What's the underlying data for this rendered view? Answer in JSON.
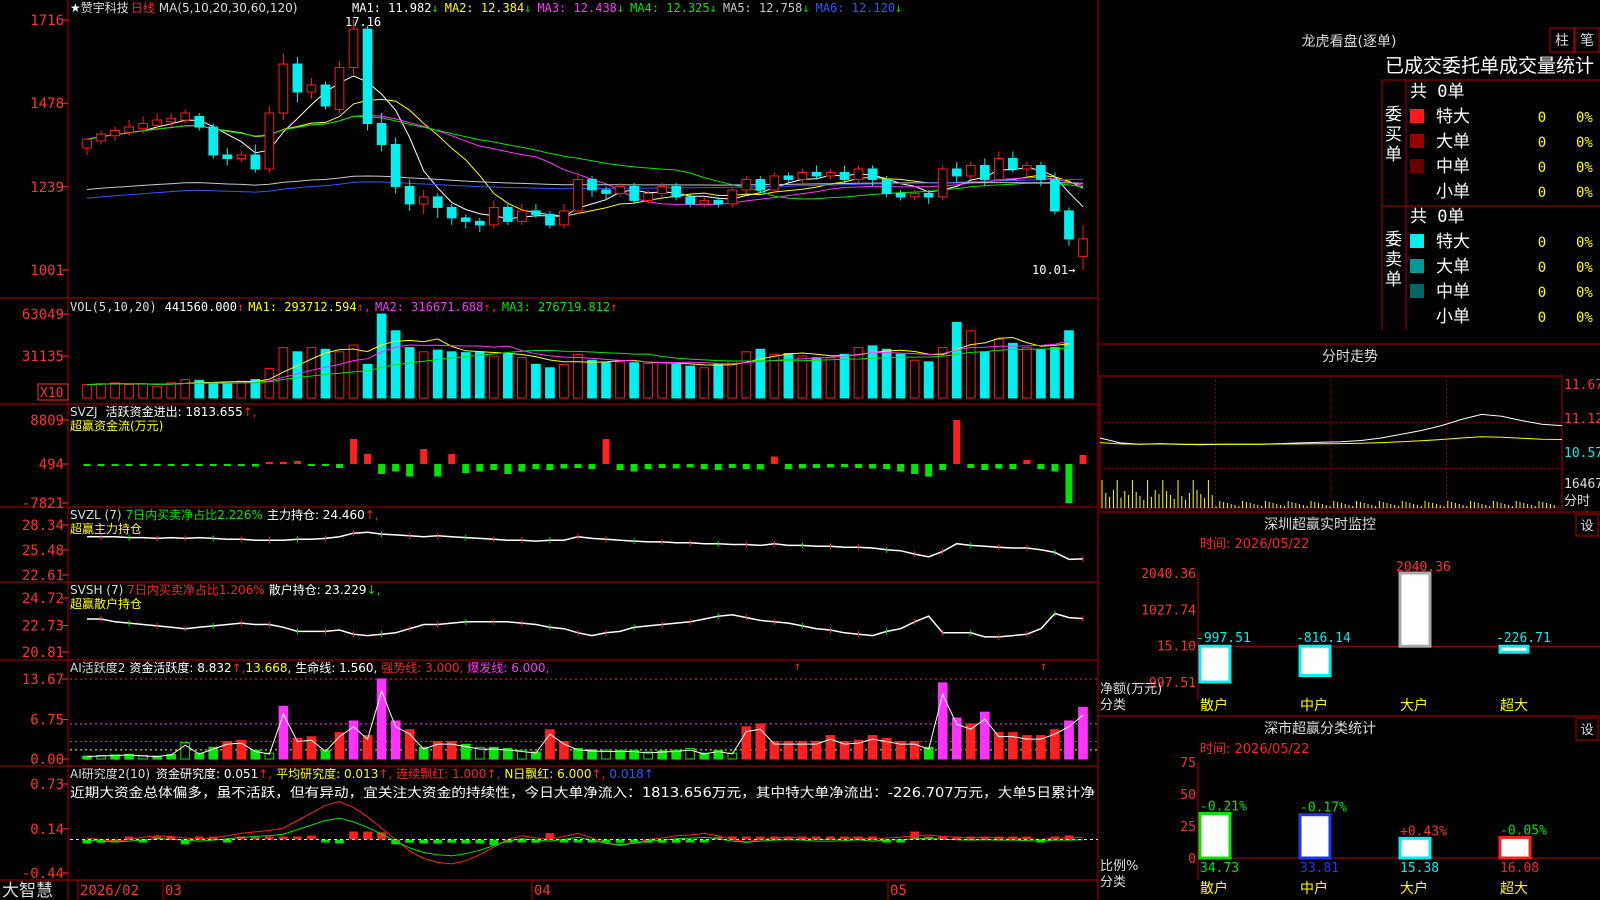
{
  "colors": {
    "up": "#ff1a1a",
    "down": "#00f0f0",
    "green": "#00e600",
    "red": "#ff2020",
    "magenta": "#ff33ff",
    "yellow": "#ffff00",
    "white": "#ffffff",
    "frame": "#b00000"
  },
  "stock": {
    "star": "★",
    "name": "赞宇科技",
    "period": "日线",
    "ma_label": "MA(5,10,20,30,60,120)"
  },
  "ma_legend": [
    {
      "t": "MA1: 11.982",
      "a": "↓",
      "c": "#ffffff"
    },
    {
      "t": "MA2: 12.384",
      "a": "↓",
      "c": "#ffff00"
    },
    {
      "t": "MA3: 12.438",
      "a": "↓",
      "c": "#ff33ff"
    },
    {
      "t": "MA4: 12.325",
      "a": "↓",
      "c": "#00e600"
    },
    {
      "t": "MA5: 12.758",
      "a": "↓",
      "c": "#c8c8c8"
    },
    {
      "t": "MA6: 12.120",
      "a": "↓",
      "c": "#3355ff"
    }
  ],
  "price_axis": [
    "1716",
    "1478",
    "1239",
    "1001"
  ],
  "price_high_label": "17.16",
  "price_low_label": "10.01→",
  "vol": {
    "label": "VOL(5,10,20)",
    "val": "441560.000",
    "a": "↑",
    "ma1": "MA1: 293712.594",
    "ma2": "MA2: 316671.688",
    "ma3": "MA3: 276719.812",
    "axis": [
      "63049",
      "31135"
    ],
    "unit": "X10"
  },
  "svzj": {
    "label": "SVZJ",
    "sub": "活跃资金进出: 1813.655",
    "a": "↑,",
    "name": "超赢资金流(万元)",
    "axis": [
      "8809",
      "494",
      "-7821"
    ]
  },
  "svzl": {
    "label": "SVZL (7)",
    "desc": "7日内买卖净占比2.226%",
    "hold": "主力持仓: 24.460",
    "a": "↑,",
    "name": "超赢主力持仓",
    "axis": [
      "28.34",
      "25.48",
      "22.61"
    ]
  },
  "svsh": {
    "label": "SVSH (7)",
    "desc": "7日内买卖净占比1.206%",
    "hold": "散户持仓: 23.229",
    "a": "↓,",
    "name": "超赢散户持仓",
    "axis": [
      "24.72",
      "22.73",
      "20.81"
    ]
  },
  "ai2": {
    "label": "AI活跃度2",
    "t1": "资金活跃度: 8.832",
    "t2": "13.668,",
    "t3": "生命线: 1.560,",
    "t4": "强势线: 3.000,",
    "t5": "爆发线: 6.000,",
    "axis": [
      "13.67",
      "6.75",
      "0.00"
    ]
  },
  "ai_res": {
    "label": "AI研究度2(10)",
    "t1": "资金研究度: 0.051",
    "t2": "平均研究度: 0.013",
    "t3": "连续飘红: 1.000",
    "t4": "N日飘红: 6.000",
    "t5": "0.018",
    "comment": "近期大资金总体偏多，虽不活跃，但有异动，宜关注大资金的持续性，今日大单净流入：1813.656万元，其中特大单净流出：-226.707万元，大单5日累计净",
    "axis": [
      "0.73",
      "0.14",
      "-0.44"
    ]
  },
  "date_axis": {
    "brand": "大智慧",
    "labels": [
      "2026/02",
      "03",
      "04",
      "05"
    ]
  },
  "panel_lh": {
    "title": "龙虎看盘(逐单)",
    "btn1": "柱",
    "btn2": "笔",
    "header": "已成交委托单成交量统计",
    "buy": {
      "side": "委买单",
      "total": "共 0单",
      "rows": [
        {
          "name": "特大",
          "v": "0",
          "p": "0%",
          "c": "#ff1a1a"
        },
        {
          "name": "大单",
          "v": "0",
          "p": "0%",
          "c": "#990000"
        },
        {
          "name": "中单",
          "v": "0",
          "p": "0%",
          "c": "#660000"
        },
        {
          "name": "小单",
          "v": "0",
          "p": "0%",
          "c": ""
        }
      ]
    },
    "sell": {
      "side": "委卖单",
      "total": "共 0单",
      "rows": [
        {
          "name": "特大",
          "v": "0",
          "p": "0%",
          "c": "#00f0f0"
        },
        {
          "name": "大单",
          "v": "0",
          "p": "0%",
          "c": "#009999"
        },
        {
          "name": "中单",
          "v": "0",
          "p": "0%",
          "c": "#006666"
        },
        {
          "name": "小单",
          "v": "0",
          "p": "0%",
          "c": ""
        }
      ]
    }
  },
  "panel_fs": {
    "title": "分时走势",
    "axis": [
      "11.67",
      "11.12",
      "10.57"
    ],
    "vol": "16467",
    "vol_unit": "分时"
  },
  "panel_sz": {
    "title": "深圳超赢实时监控",
    "btn": "设",
    "time": "时间: 2026/05/22",
    "ylabel1": "净额(万元)",
    "ylabel2": "分类",
    "axis": [
      "2040.36",
      "1027.74",
      "15.10",
      "-997.51"
    ]
  },
  "panel_cls": {
    "title": "深市超赢分类统计",
    "btn": "设",
    "time": "时间: 2026/05/22",
    "ylabel1": "比例%",
    "ylabel2": "分类",
    "axis": [
      "75",
      "50",
      "25",
      "0"
    ]
  },
  "chart_data": [
    {
      "type": "candlestick",
      "title": "赞宇科技 日线",
      "ylim": [
        10.01,
        17.16
      ],
      "candles": [
        [
          13.5,
          13.75,
          13.3,
          13.8
        ],
        [
          13.7,
          13.9,
          13.6,
          14.0
        ],
        [
          13.85,
          14.0,
          13.7,
          14.1
        ],
        [
          13.95,
          14.1,
          13.85,
          14.3
        ],
        [
          14.05,
          14.2,
          13.9,
          14.4
        ],
        [
          14.15,
          14.3,
          14.0,
          14.5
        ],
        [
          14.25,
          14.35,
          14.1,
          14.5
        ],
        [
          14.3,
          14.5,
          14.2,
          14.6
        ],
        [
          14.4,
          14.1,
          14.0,
          14.5
        ],
        [
          14.1,
          13.3,
          13.2,
          14.2
        ],
        [
          13.3,
          13.2,
          13.0,
          13.5
        ],
        [
          13.2,
          13.3,
          13.1,
          13.4
        ],
        [
          13.3,
          12.9,
          12.8,
          13.6
        ],
        [
          12.9,
          14.5,
          12.8,
          14.7
        ],
        [
          14.5,
          15.9,
          14.3,
          16.2
        ],
        [
          15.9,
          15.1,
          14.8,
          16.1
        ],
        [
          15.1,
          15.3,
          14.9,
          15.5
        ],
        [
          15.3,
          14.7,
          14.6,
          15.4
        ],
        [
          14.6,
          15.8,
          14.5,
          16.0
        ],
        [
          15.8,
          16.9,
          15.6,
          17.16
        ],
        [
          16.9,
          14.2,
          14.0,
          17.0
        ],
        [
          14.2,
          13.6,
          13.4,
          14.5
        ],
        [
          13.6,
          12.4,
          12.2,
          13.8
        ],
        [
          12.4,
          11.9,
          11.7,
          12.6
        ],
        [
          11.9,
          12.1,
          11.6,
          12.3
        ],
        [
          12.1,
          11.8,
          11.5,
          12.2
        ],
        [
          11.8,
          11.5,
          11.3,
          11.9
        ],
        [
          11.5,
          11.4,
          11.2,
          11.6
        ],
        [
          11.4,
          11.3,
          11.1,
          11.5
        ],
        [
          11.3,
          11.8,
          11.2,
          12.0
        ],
        [
          11.8,
          11.4,
          11.3,
          11.9
        ],
        [
          11.4,
          11.7,
          11.3,
          11.9
        ],
        [
          11.7,
          11.6,
          11.5,
          11.9
        ],
        [
          11.6,
          11.3,
          11.2,
          11.7
        ],
        [
          11.3,
          11.7,
          11.2,
          11.9
        ],
        [
          11.7,
          12.6,
          11.6,
          12.8
        ],
        [
          12.6,
          12.3,
          12.1,
          12.7
        ],
        [
          12.3,
          12.2,
          12.0,
          12.4
        ],
        [
          12.2,
          12.4,
          12.1,
          12.5
        ],
        [
          12.4,
          12.0,
          11.9,
          12.5
        ],
        [
          12.0,
          12.2,
          11.9,
          12.3
        ],
        [
          12.2,
          12.4,
          12.1,
          12.5
        ],
        [
          12.4,
          12.1,
          12.0,
          12.5
        ],
        [
          12.1,
          11.9,
          11.8,
          12.2
        ],
        [
          11.9,
          12.0,
          11.8,
          12.1
        ],
        [
          12.0,
          11.9,
          11.8,
          12.1
        ],
        [
          11.9,
          12.3,
          11.8,
          12.4
        ],
        [
          12.3,
          12.6,
          12.2,
          12.7
        ],
        [
          12.6,
          12.3,
          12.2,
          12.7
        ],
        [
          12.3,
          12.7,
          12.2,
          12.8
        ],
        [
          12.7,
          12.6,
          12.5,
          12.8
        ],
        [
          12.6,
          12.8,
          12.5,
          12.9
        ],
        [
          12.8,
          12.7,
          12.6,
          13.0
        ],
        [
          12.7,
          12.8,
          12.6,
          12.9
        ],
        [
          12.8,
          12.6,
          12.5,
          13.0
        ],
        [
          12.6,
          12.9,
          12.5,
          13.0
        ],
        [
          12.9,
          12.6,
          12.4,
          13.0
        ],
        [
          12.6,
          12.2,
          12.1,
          12.7
        ],
        [
          12.2,
          12.1,
          12.0,
          12.3
        ],
        [
          12.1,
          12.2,
          12.0,
          12.3
        ],
        [
          12.2,
          12.1,
          11.9,
          12.3
        ],
        [
          12.1,
          12.9,
          12.0,
          13.0
        ],
        [
          12.9,
          12.7,
          12.5,
          13.1
        ],
        [
          12.7,
          13.0,
          12.6,
          13.1
        ],
        [
          13.0,
          12.6,
          12.4,
          13.2
        ],
        [
          12.6,
          13.2,
          12.5,
          13.4
        ],
        [
          13.2,
          12.9,
          12.8,
          13.4
        ],
        [
          12.9,
          13.0,
          12.7,
          13.1
        ],
        [
          13.0,
          12.6,
          12.4,
          13.1
        ],
        [
          12.6,
          11.7,
          11.6,
          12.8
        ],
        [
          11.7,
          10.9,
          10.7,
          11.8
        ],
        [
          10.4,
          10.9,
          10.01,
          11.3
        ]
      ]
    },
    {
      "type": "bar",
      "title": "VOL(5,10,20)",
      "values": [
        16,
        17,
        18,
        16,
        17,
        14,
        18,
        22,
        21,
        18,
        17,
        20,
        22,
        35,
        60,
        55,
        60,
        58,
        55,
        63,
        40,
        100,
        80,
        60,
        55,
        57,
        55,
        54,
        55,
        50,
        52,
        48,
        40,
        36,
        40,
        52,
        45,
        42,
        43,
        42,
        41,
        42,
        40,
        38,
        36,
        40,
        44,
        55,
        58,
        52,
        53,
        50,
        48,
        48,
        52,
        60,
        62,
        58,
        52,
        45,
        43,
        60,
        90,
        80,
        55,
        70,
        65,
        60,
        58,
        60,
        80
      ],
      "ylim": [
        0,
        100
      ]
    },
    {
      "type": "bar",
      "title": "超赢资金流(万元)",
      "values": [
        -100,
        -80,
        -120,
        -90,
        -150,
        -200,
        -180,
        -100,
        -300,
        -400,
        -300,
        -200,
        -500,
        200,
        400,
        600,
        -300,
        -200,
        -800,
        5000,
        2000,
        -2000,
        -1500,
        -2500,
        3000,
        -2500,
        2000,
        -1800,
        -1500,
        -1200,
        -2000,
        -1500,
        -1000,
        -1200,
        -900,
        -800,
        -1000,
        5000,
        -1200,
        -1500,
        -1000,
        -800,
        -900,
        -700,
        -1000,
        -1200,
        -800,
        -1000,
        -1100,
        1500,
        -1000,
        -900,
        -800,
        -700,
        -600,
        -800,
        -900,
        -1000,
        -1500,
        -2000,
        -2500,
        -1200,
        8809,
        -800,
        -1200,
        -900,
        -1000,
        800,
        -1000,
        -1500,
        -7821,
        1813.655
      ]
    },
    {
      "type": "line",
      "title": "超赢主力持仓",
      "ylim": [
        22.61,
        28.34
      ],
      "values": [
        27.0,
        27.0,
        27.0,
        26.9,
        26.9,
        26.8,
        26.9,
        26.8,
        26.9,
        26.8,
        26.7,
        26.7,
        26.6,
        26.6,
        26.6,
        26.7,
        26.7,
        26.8,
        27.0,
        27.4,
        27.5,
        27.3,
        27.2,
        27.1,
        27.0,
        27.1,
        27.0,
        26.9,
        26.8,
        26.7,
        26.6,
        26.6,
        26.5,
        26.6,
        26.6,
        27.0,
        26.8,
        26.7,
        26.6,
        26.5,
        26.4,
        26.4,
        26.3,
        26.3,
        26.2,
        26.2,
        26.1,
        26.1,
        26.0,
        26.2,
        26.0,
        26.0,
        25.9,
        25.9,
        25.8,
        25.8,
        25.7,
        25.5,
        25.4,
        25.0,
        24.7,
        25.3,
        26.2,
        26.0,
        25.9,
        25.8,
        25.7,
        25.7,
        25.5,
        25.2,
        24.4,
        24.46
      ]
    },
    {
      "type": "line",
      "title": "超赢散户持仓",
      "ylim": [
        20.81,
        24.72
      ],
      "values": [
        23.2,
        23.2,
        23.0,
        22.9,
        22.8,
        22.7,
        22.6,
        22.5,
        22.6,
        22.7,
        22.8,
        22.9,
        22.8,
        22.8,
        22.6,
        22.3,
        22.3,
        22.3,
        22.4,
        22.1,
        22.0,
        22.1,
        22.2,
        22.5,
        22.8,
        22.8,
        22.9,
        23.0,
        23.0,
        23.0,
        23.0,
        22.9,
        22.8,
        22.6,
        22.5,
        22.2,
        22.0,
        22.2,
        22.3,
        22.6,
        22.7,
        22.8,
        22.9,
        23.0,
        23.2,
        23.4,
        23.5,
        23.3,
        23.1,
        23.0,
        22.9,
        22.7,
        22.5,
        22.4,
        22.2,
        22.1,
        22.0,
        22.3,
        22.5,
        23.0,
        23.4,
        22.2,
        22.2,
        22.2,
        21.9,
        21.9,
        22.0,
        22.1,
        22.5,
        23.6,
        23.3,
        23.229
      ]
    },
    {
      "type": "bar",
      "title": "AI活跃度2",
      "ylim": [
        0,
        13.67
      ],
      "values": [
        0.5,
        0.6,
        0.7,
        0.8,
        0.6,
        0.5,
        0.8,
        2.8,
        1.0,
        2.0,
        3.0,
        3.2,
        1.5,
        1.0,
        9.0,
        3.5,
        3.8,
        1.5,
        4.5,
        6.5,
        4.0,
        13.67,
        6.5,
        5.0,
        2.0,
        3.0,
        3.0,
        2.5,
        2.0,
        2.0,
        1.8,
        1.5,
        1.2,
        5.0,
        3.0,
        1.8,
        1.6,
        1.5,
        1.5,
        1.5,
        1.2,
        1.4,
        1.5,
        1.8,
        1.0,
        1.5,
        1.0,
        5.5,
        6.0,
        3.0,
        3.0,
        3.0,
        3.0,
        4.0,
        3.0,
        3.2,
        4.0,
        3.5,
        3.0,
        3.0,
        2.0,
        13.0,
        7.0,
        6.0,
        8.0,
        4.5,
        4.5,
        4.0,
        4.0,
        5.0,
        6.5,
        8.832
      ]
    },
    {
      "type": "bar",
      "title": "AI研究度2(10)",
      "ylim": [
        -0.44,
        0.73
      ],
      "values": [
        -0.05,
        -0.04,
        -0.03,
        0.0,
        -0.03,
        0.03,
        0.03,
        -0.06,
        0.03,
        0.02,
        -0.02,
        0.0,
        0.03,
        0.02,
        0.03,
        0.03,
        0.05,
        -0.03,
        -0.05,
        0.1,
        0.1,
        0.09,
        -0.06,
        -0.04,
        -0.05,
        -0.05,
        -0.04,
        -0.05,
        -0.05,
        -0.07,
        -0.02,
        -0.03,
        -0.04,
        0.08,
        -0.03,
        -0.03,
        -0.03,
        -0.04,
        -0.04,
        -0.04,
        -0.04,
        -0.04,
        -0.04,
        -0.03,
        -0.02,
        0.0,
        0.03,
        0.03,
        0.03,
        0.03,
        0.03,
        0.03,
        0.03,
        0.03,
        0.02,
        0.02,
        0.02,
        -0.02,
        -0.03,
        0.1,
        0.03,
        0.03,
        0.02,
        0.02,
        0.03,
        0.03,
        0.03,
        0.03,
        -0.03,
        0.0,
        0.051
      ]
    },
    {
      "type": "line",
      "title": "分时走势",
      "ylim": [
        10.3,
        11.67
      ],
      "values": [
        10.8,
        10.72,
        10.7,
        10.71,
        10.7,
        10.69,
        10.7,
        10.7,
        10.7,
        10.71,
        10.72,
        10.73,
        10.74,
        10.76,
        10.8,
        10.86,
        10.92,
        11.0,
        11.1,
        11.18,
        11.15,
        11.08,
        11.02,
        11.0
      ]
    },
    {
      "type": "bar",
      "title": "深圳超赢实时监控",
      "categories": [
        "散户",
        "中户",
        "大户",
        "超大"
      ],
      "values": [
        -997.51,
        -816.14,
        2040.36,
        -226.71
      ],
      "ylim": [
        -997.51,
        2040.36
      ]
    },
    {
      "type": "bar",
      "title": "深市超赢分类统计",
      "categories": [
        "散户",
        "中户",
        "大户",
        "超大"
      ],
      "values": [
        34.73,
        33.81,
        15.38,
        16.08
      ],
      "changes": [
        "-0.21%",
        "-0.17%",
        "+0.43%",
        "-0.05%"
      ],
      "ylim": [
        0,
        75
      ]
    }
  ]
}
